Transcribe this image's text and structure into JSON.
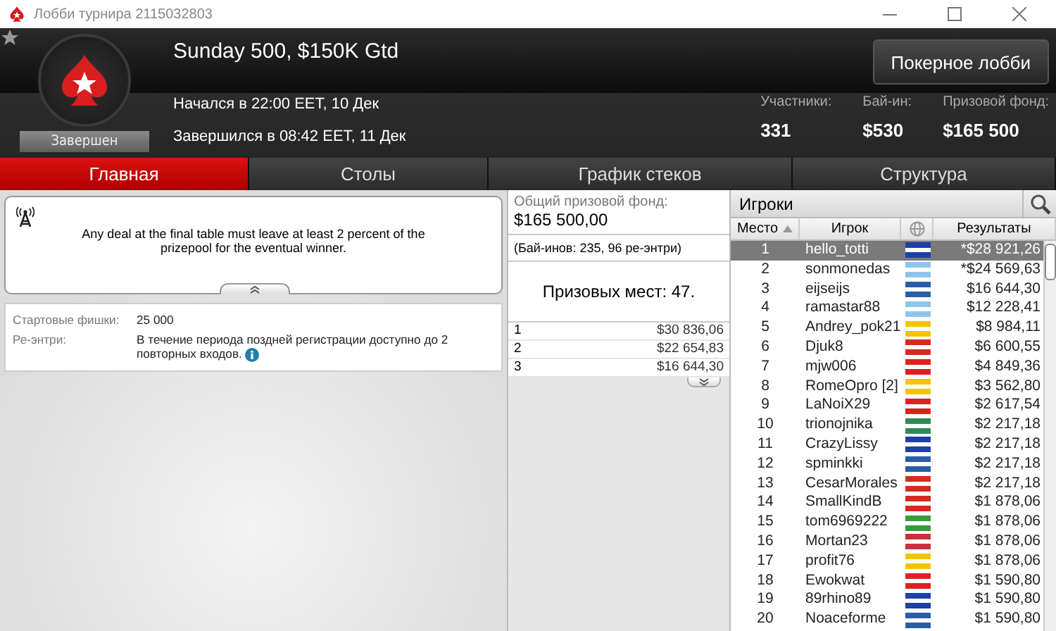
{
  "window": {
    "title": "Лобби турнира 2115032803"
  },
  "header": {
    "title": "Sunday 500, $150K Gtd",
    "status": "Завершен",
    "started": "Начался в 22:00 EET, 10 Дек",
    "ended": "Завершился в 08:42 EET, 11 Дек",
    "lobby_button": "Покерное лобби",
    "stats": [
      {
        "label": "Участники:",
        "value": "331"
      },
      {
        "label": "Бай-ин:",
        "value": "$530"
      },
      {
        "label": "Призовой фонд:",
        "value": "$165 500"
      }
    ]
  },
  "tabs": [
    {
      "label": "Главная",
      "selected": true
    },
    {
      "label": "Столы",
      "selected": false
    },
    {
      "label": "График стеков",
      "selected": false
    },
    {
      "label": "Структура",
      "selected": false
    }
  ],
  "notice": {
    "text": "Any deal at the final table must leave at least 2 percent of the prizepool for the eventual winner."
  },
  "details": [
    {
      "label": "Стартовые фишки:",
      "value": "25 000"
    },
    {
      "label": "Ре-энтри:",
      "value": "В течение периода поздней регистрации доступно до 2 повторных входов.",
      "info": true
    }
  ],
  "prize": {
    "label": "Общий призовой фонд:",
    "total": "$165 500,00",
    "buyins": "(Бай-инов: 235, 96 ре-энтри)",
    "places": "Призовых мест: 47.",
    "rows": [
      {
        "place": "1",
        "amount": "$30 836,06"
      },
      {
        "place": "2",
        "amount": "$22 654,83"
      },
      {
        "place": "3",
        "amount": "$16 644,30"
      }
    ]
  },
  "players": {
    "title": "Игроки",
    "columns": [
      "Место",
      "Игрок",
      "Результаты"
    ],
    "rows": [
      {
        "place": "1",
        "name": "hello_totti",
        "result": "*$28 921,26",
        "color": "#1c3fa8",
        "selected": true
      },
      {
        "place": "2",
        "name": "sonmonedas",
        "result": "*$24 569,63",
        "color": "#8ec5ea",
        "selected": false
      },
      {
        "place": "3",
        "name": "eijseijs",
        "result": "$16 644,30",
        "color": "#2a5da8",
        "selected": false
      },
      {
        "place": "4",
        "name": "ramastar88",
        "result": "$12 228,41",
        "color": "#8ec5ea",
        "selected": false
      },
      {
        "place": "5",
        "name": "Andrey_pok21",
        "result": "$8 984,11",
        "color": "#f2c500",
        "selected": false
      },
      {
        "place": "6",
        "name": "Djuk8",
        "result": "$6 600,55",
        "color": "#d52b1e",
        "selected": false
      },
      {
        "place": "7",
        "name": "mjw006",
        "result": "$4 849,36",
        "color": "#e02020",
        "selected": false
      },
      {
        "place": "8",
        "name": "RomeOpro [2]",
        "result": "$3 562,80",
        "color": "#f2c500",
        "selected": false
      },
      {
        "place": "9",
        "name": "LaNoiX29",
        "result": "$2 617,54",
        "color": "#e02020",
        "selected": false
      },
      {
        "place": "10",
        "name": "trionojnika",
        "result": "$2 217,18",
        "color": "#2e8b57",
        "selected": false
      },
      {
        "place": "11",
        "name": "CrazyLissy",
        "result": "$2 217,18",
        "color": "#1c3fa8",
        "selected": false
      },
      {
        "place": "12",
        "name": "spminkki",
        "result": "$2 217,18",
        "color": "#2a5da8",
        "selected": false
      },
      {
        "place": "13",
        "name": "CesarMorales",
        "result": "$2 217,18",
        "color": "#d52b1e",
        "selected": false
      },
      {
        "place": "14",
        "name": "SmallKindB",
        "result": "$1 878,06",
        "color": "#d52b1e",
        "selected": false
      },
      {
        "place": "15",
        "name": "tom6969222",
        "result": "$1 878,06",
        "color": "#3a9a3a",
        "selected": false
      },
      {
        "place": "16",
        "name": "Mortan23",
        "result": "$1 878,06",
        "color": "#c8323c",
        "selected": false
      },
      {
        "place": "17",
        "name": "profit76",
        "result": "$1 878,06",
        "color": "#f2c500",
        "selected": false
      },
      {
        "place": "18",
        "name": "Ewokwat",
        "result": "$1 590,80",
        "color": "#e02020",
        "selected": false
      },
      {
        "place": "19",
        "name": "89rhino89",
        "result": "$1 590,80",
        "color": "#1c3fa8",
        "selected": false
      },
      {
        "place": "20",
        "name": "Noaceforme",
        "result": "$1 590,80",
        "color": "#2a5da8",
        "selected": false
      }
    ]
  }
}
